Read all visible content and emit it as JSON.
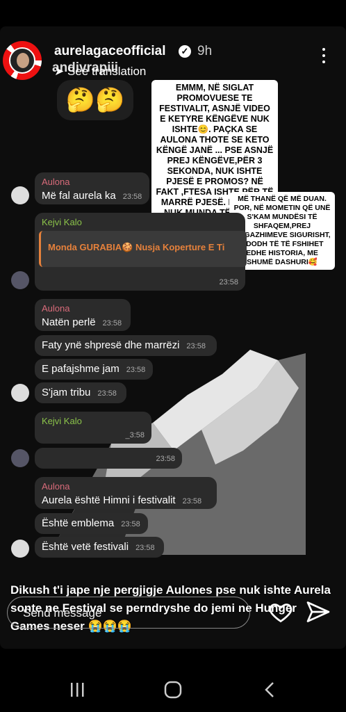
{
  "header": {
    "username": "aurelagaceofficial",
    "verified_mark": "✓",
    "time": "9h",
    "tagged_user": "andivrapiii",
    "translation_link": "See translation"
  },
  "emoji_reply": "🤔🤔",
  "notes": {
    "note1": "EMMM, NË SIGLAT PROMOVUESE TE FESTIVALIT, ASNJË VIDEO E KETYRE KËNGËVE NUK ISHTE😊. PAÇKA SE AULONA THOTE SE KETO KËNGË JANË ... PSE ASNJË PREJ KËNGËVE,PËR 3 SEKONDA, NUK ISHTE PJESË E PROMOS? NË FAKT ,FTESA ISHTE PËR TË MARRË PJESË. FAKTI QË NUK MUNDA TË JEM NË SKENË,MBASE BËRI TË MË FSHIJNË EDHE NGA VIDEOT PROMOVUESE😅",
    "note2": "MË THANË QË MË DUAN. POR, NË MOMETIN QË UNË S'KAM MUNDËSI TË SHFAQEM,PREJ ANGAZHIMEVE SIGURISHT, NDODH TË TË FSHIHET EDHE HISTORIA, ME SHUMË DASHURI🥰"
  },
  "chat": [
    {
      "sender": "Aulona",
      "text": "Më fal aurela ka",
      "time": "23:58"
    },
    {
      "sender": "Kejvi Kalo",
      "quote": "Monda GURABIA🍪 Nusja Koperture E Ti",
      "time": "23:58"
    },
    {
      "sender": "Aulona",
      "text": "Natën perlë",
      "time": "23:58"
    },
    {
      "text": "Faty ynë shpresë dhe marrëzi",
      "time": "23:58"
    },
    {
      "text": "E pafajshme jam",
      "time": "23:58"
    },
    {
      "text": "S'jam tribu",
      "time": "23:58"
    },
    {
      "sender": "Kejvi Kalo",
      "time": "_3:58"
    },
    {
      "time": "23:58"
    },
    {
      "sender": "Aulona",
      "text": "Aurela është Himni i festivalit",
      "time": "23:58"
    },
    {
      "text": "Është emblema",
      "time": "23:58"
    },
    {
      "text": "Është vetë festivali",
      "time": "23:58"
    }
  ],
  "caption": "Dikush t'i jape nje pergjigje Aulones pse nuk ishte Aurela sonte ne Festival se perndryshe do jemi ne Hunger Games neser 😭😭😭",
  "composer": {
    "placeholder": "Send message"
  },
  "colors": {
    "aulona": "#d96b7a",
    "kejvi": "#8bc34a",
    "quote_accent": "#e6813b"
  }
}
